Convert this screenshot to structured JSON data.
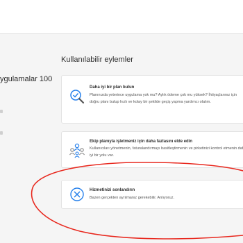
{
  "left": {
    "plan_title": "ygulamalar 100"
  },
  "main": {
    "section_title": "Kullanılabilir eylemler",
    "cards": [
      {
        "icon": "search-check-icon",
        "title": "Daha iyi bir plan bulun",
        "description": "Planınızda yeterince uygulama yok mu? Aylık ödeme çok mu yüksek? İhtiyaçlarınız için doğru planı bulup hızlı ve kolay bir şekilde geçiş yapma yardımcı olalım."
      },
      {
        "icon": "team-icon",
        "title": "Ekip planıyla işletmeniz için daha fazlasını elde edin",
        "description": "Kullanıcıları yönetmenin, faturalandırmayı basitleştirmenin ve pirketinizi kontrol etmenin daha iyi bir yolu var."
      },
      {
        "icon": "cancel-x-icon",
        "title": "Hizmetinizi sonlandırın",
        "description": "Bazen gerçekten ayrılmanız gerekebilir. Anlıyoruz."
      }
    ]
  },
  "colors": {
    "accent_blue": "#2680eb",
    "annotation_red": "#e8281e"
  }
}
